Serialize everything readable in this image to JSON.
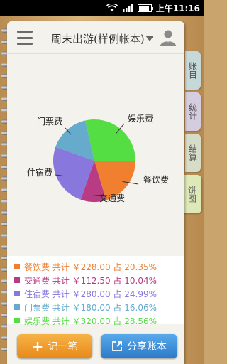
{
  "status_bar": {
    "time": "上午11:16"
  },
  "header": {
    "book_title": "周末出游(样例帐本)"
  },
  "tabs": [
    {
      "label": "账目"
    },
    {
      "label": "统计"
    },
    {
      "label": "结算"
    },
    {
      "label": "饼图"
    }
  ],
  "chart_data": {
    "type": "pie",
    "slices": [
      {
        "label": "餐饮费",
        "value": 228.0,
        "percent": 20.35,
        "color": "#f08030"
      },
      {
        "label": "交通费",
        "value": 112.5,
        "percent": 10.04,
        "color": "#b83c84"
      },
      {
        "label": "住宿费",
        "value": 280.0,
        "percent": 24.99,
        "color": "#8877dd"
      },
      {
        "label": "门票费",
        "value": 180.0,
        "percent": 16.06,
        "color": "#66aacc"
      },
      {
        "label": "娱乐费",
        "value": 320.0,
        "percent": 28.56,
        "color": "#55dd44"
      }
    ]
  },
  "summary": {
    "rows": [
      {
        "text": "餐饮费 共计 ￥228.00 占  20.35%",
        "color": "#f08030"
      },
      {
        "text": "交通费 共计 ￥112.50 占  10.04%",
        "color": "#b83c84"
      },
      {
        "text": "住宿费 共计 ￥280.00 占  24.99%",
        "color": "#8877dd"
      },
      {
        "text": "门票费 共计 ￥180.00 占  16.06%",
        "color": "#66aacc"
      },
      {
        "text": "娱乐费 共计 ￥320.00 占  28.56%",
        "color": "#55dd44"
      }
    ]
  },
  "buttons": {
    "record_label": "记一笔",
    "share_label": "分享账本"
  },
  "icons": {
    "menu": "menu-icon",
    "dropdown": "chevron-down-icon",
    "user": "user-icon",
    "plus": "plus-icon",
    "share": "share-icon"
  }
}
